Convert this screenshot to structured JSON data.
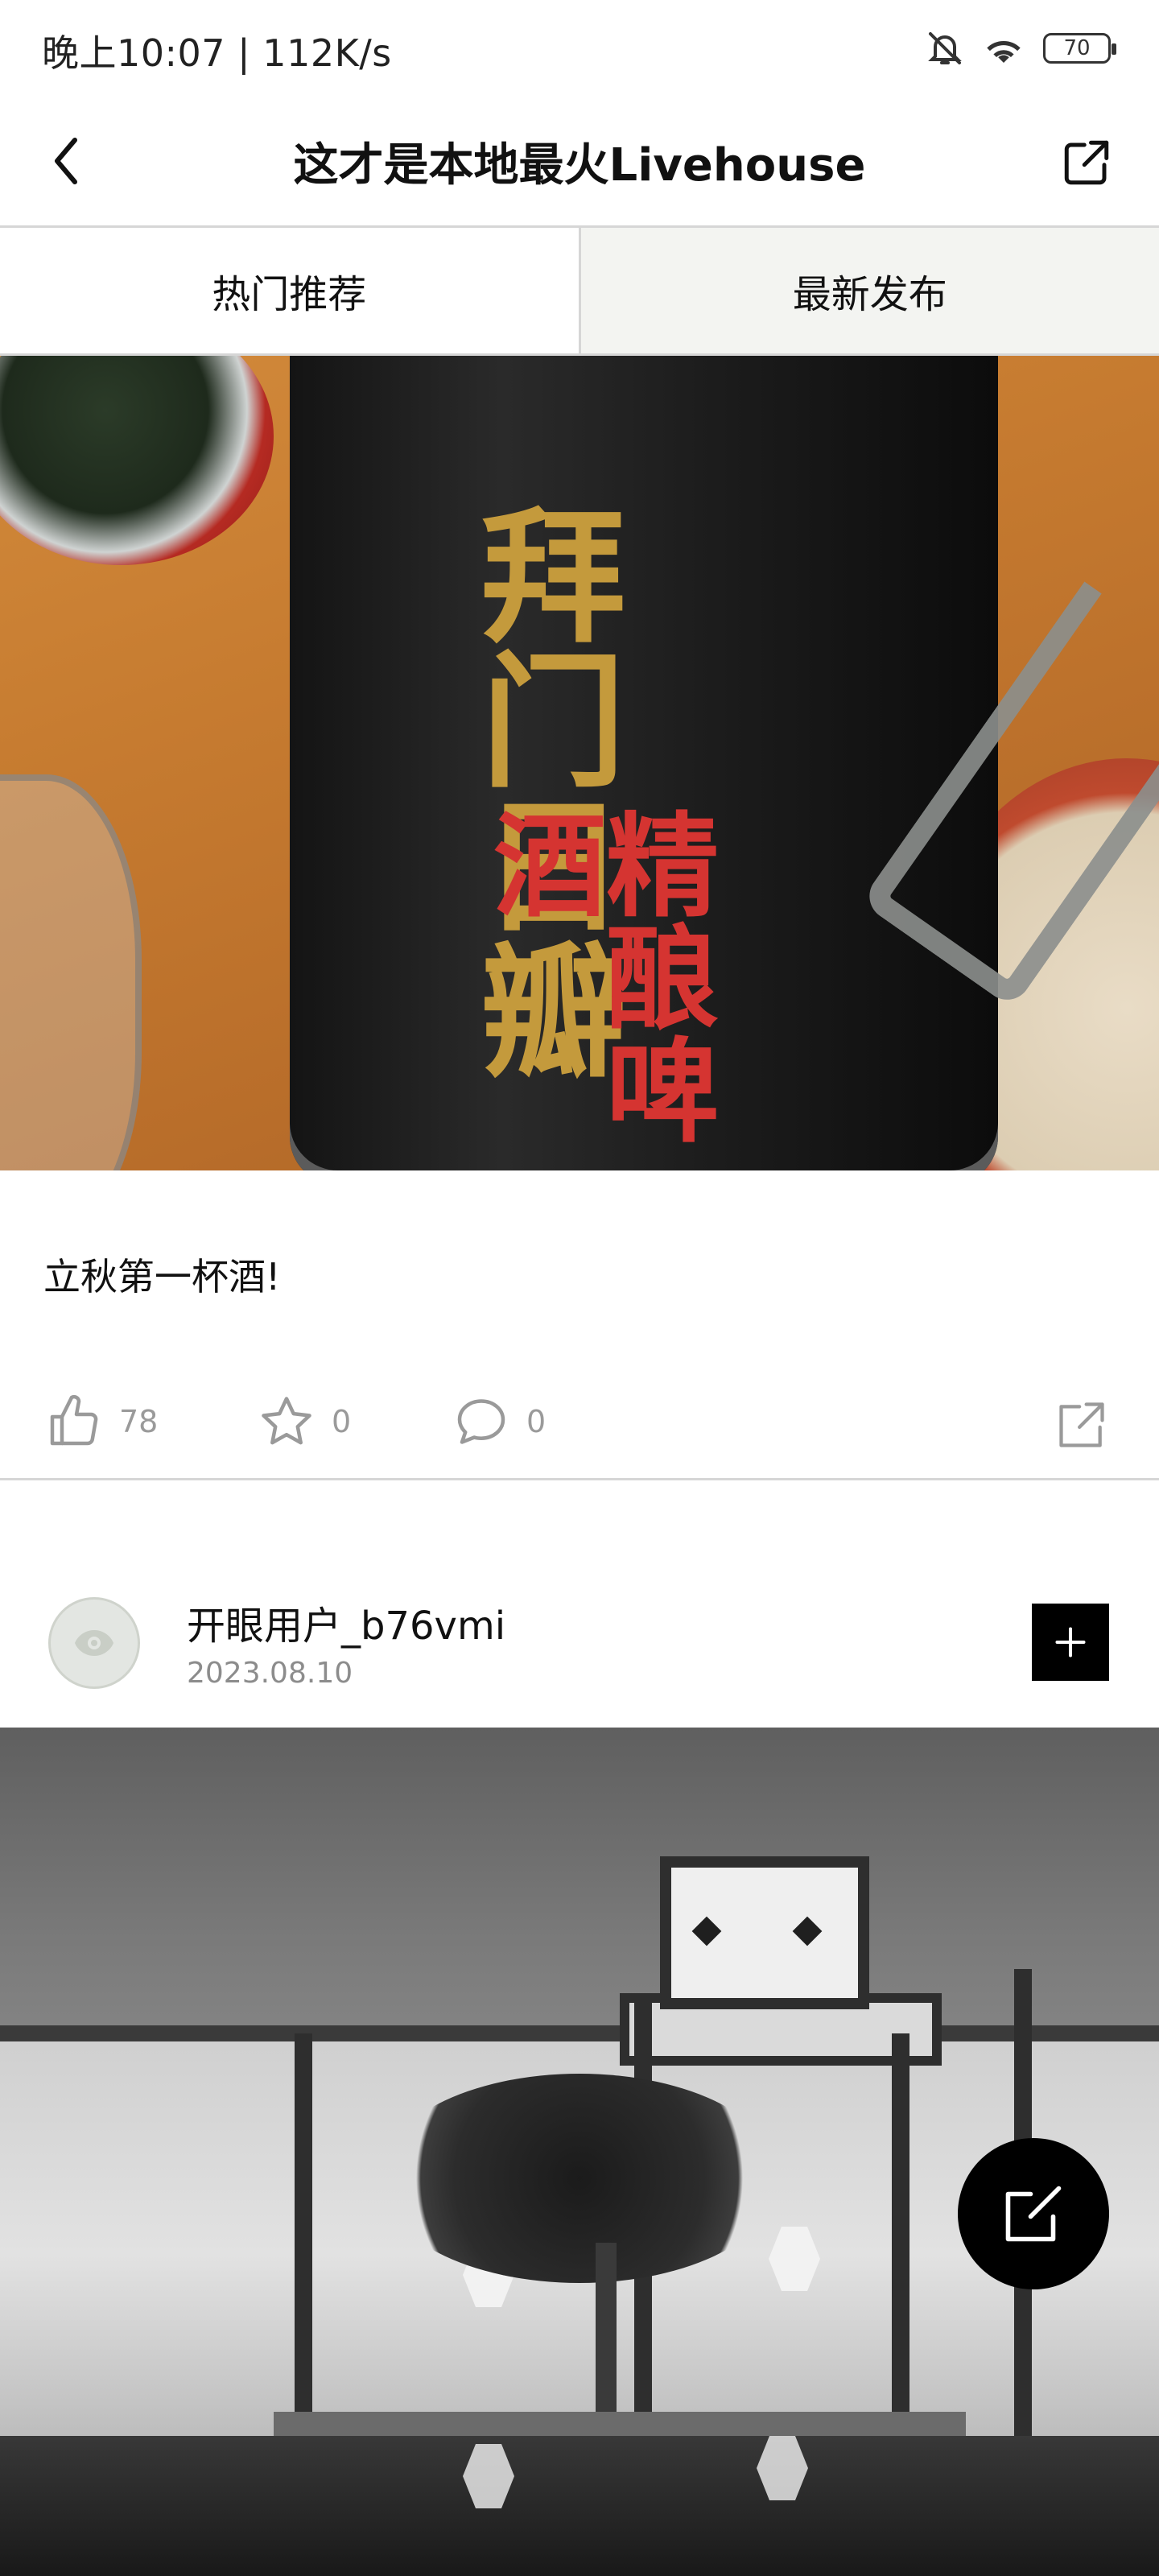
{
  "status_bar": {
    "time_speed": "晚上10:07 | 112K/s",
    "battery": "70",
    "icons": [
      "mute-bell-icon",
      "wifi-icon",
      "battery-icon"
    ]
  },
  "header": {
    "title": "这才是本地最火Livehouse",
    "back_icon": "chevron-left-icon",
    "share_icon": "share-icon"
  },
  "tabs": [
    {
      "label": "热门推荐"
    },
    {
      "label": "最新发布"
    }
  ],
  "post1": {
    "image": "beer-can-photo",
    "image_text_main": "拜门日瓣",
    "image_text_red": "精酿啤酒",
    "text": "立秋第一杯酒!",
    "likes": "78",
    "favorites": "0",
    "comments": "0"
  },
  "post2": {
    "username": "开眼用户_b76vmi",
    "date": "2023.08.10",
    "image": "museum-photo"
  },
  "colors": {
    "accent": "#000000",
    "muted_text": "#9a9a9a",
    "divider": "#d6d6d6",
    "tab_active_bg": "#f3f4f1"
  }
}
